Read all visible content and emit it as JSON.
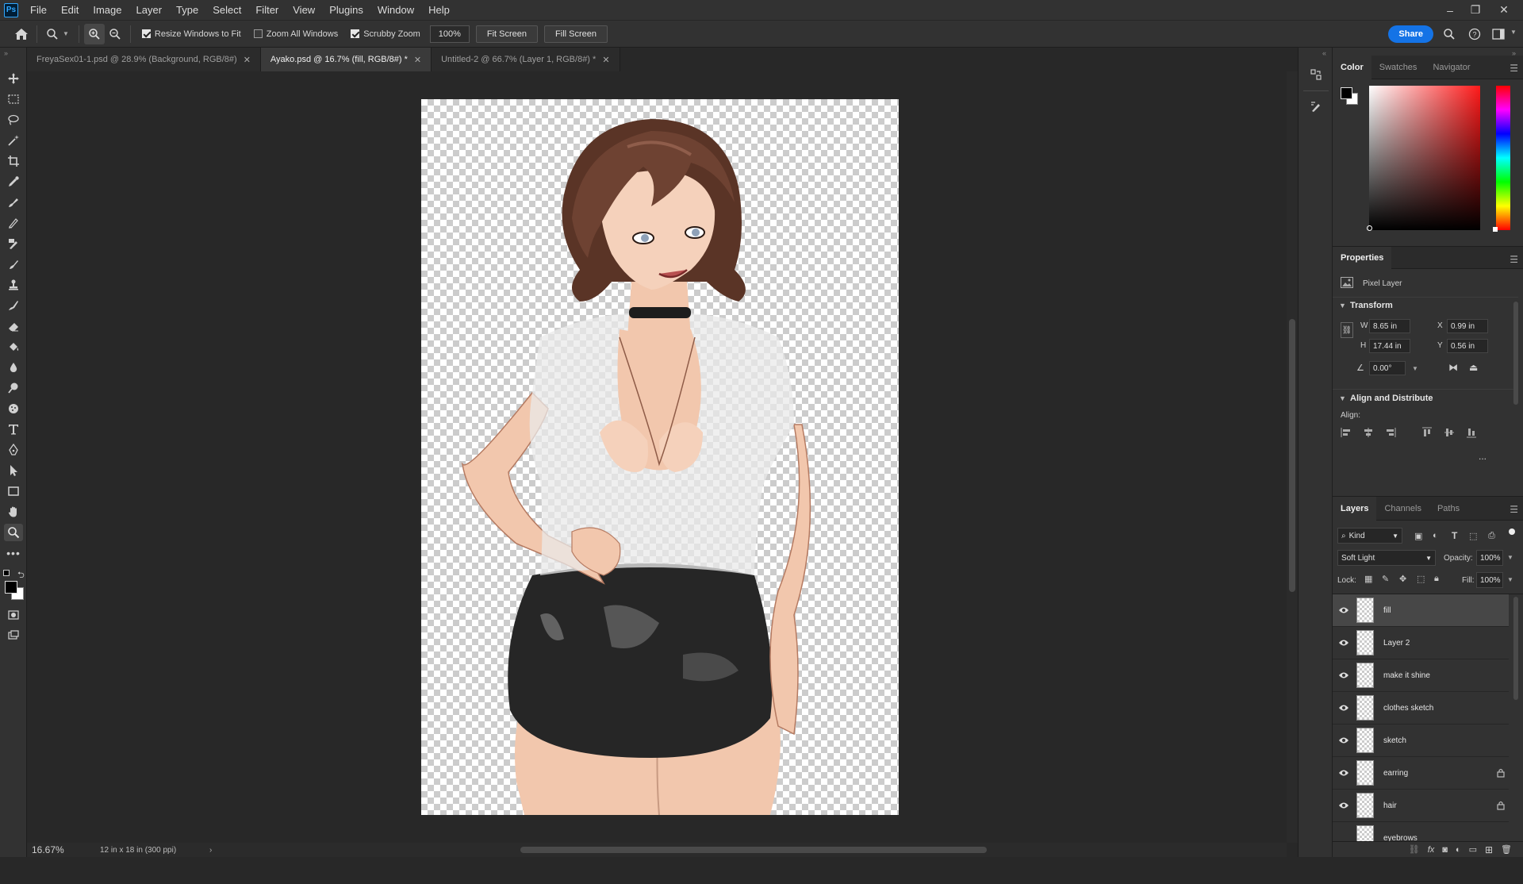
{
  "menu": {
    "app_logo": "Ps",
    "items": [
      "File",
      "Edit",
      "Image",
      "Layer",
      "Type",
      "Select",
      "Filter",
      "View",
      "Plugins",
      "Window",
      "Help"
    ]
  },
  "options": {
    "resize_windows": "Resize Windows to Fit",
    "zoom_all": "Zoom All Windows",
    "scrubby_zoom": "Scrubby Zoom",
    "zoom_value": "100%",
    "fit_screen": "Fit Screen",
    "fill_screen": "Fill Screen",
    "share": "Share",
    "resize_windows_checked": true,
    "zoom_all_checked": false,
    "scrubby_checked": true
  },
  "tabs": [
    {
      "label": "FreyaSex01-1.psd @ 28.9% (Background, RGB/8#)",
      "active": false
    },
    {
      "label": "Ayako.psd @ 16.7% (fill, RGB/8#) *",
      "active": true
    },
    {
      "label": "Untitled-2 @ 66.7% (Layer 1, RGB/8#) *",
      "active": false
    }
  ],
  "status": {
    "zoom": "16.67%",
    "doc_info": "12 in x 18 in (300 ppi)"
  },
  "color_panel": {
    "tabs": [
      "Color",
      "Swatches",
      "Navigator"
    ],
    "foreground": "#000000",
    "background": "#ffffff",
    "hue_color": "#ff1a1a"
  },
  "properties": {
    "title": "Properties",
    "layer_type": "Pixel Layer",
    "transform_title": "Transform",
    "w_label": "W",
    "w": "8.65 in",
    "h_label": "H",
    "h": "17.44 in",
    "x_label": "X",
    "x": "0.99 in",
    "y_label": "Y",
    "y": "0.56 in",
    "angle": "0.00°",
    "align_title": "Align and Distribute",
    "align_label": "Align:",
    "more": "..."
  },
  "layers_panel": {
    "tabs": [
      "Layers",
      "Channels",
      "Paths"
    ],
    "filter_kind": "Kind",
    "blend_mode": "Soft Light",
    "opacity_label": "Opacity:",
    "opacity": "100%",
    "lock_label": "Lock:",
    "fill_label": "Fill:",
    "fill": "100%",
    "layers": [
      {
        "name": "fill",
        "selected": true,
        "locked": false
      },
      {
        "name": "Layer 2",
        "selected": false,
        "locked": false
      },
      {
        "name": "make it shine",
        "selected": false,
        "locked": false
      },
      {
        "name": "clothes sketch",
        "selected": false,
        "locked": false
      },
      {
        "name": "sketch",
        "selected": false,
        "locked": false
      },
      {
        "name": "earring",
        "selected": false,
        "locked": true
      },
      {
        "name": "hair",
        "selected": false,
        "locked": true
      },
      {
        "name": "eyebrows",
        "selected": false,
        "locked": false
      }
    ]
  }
}
